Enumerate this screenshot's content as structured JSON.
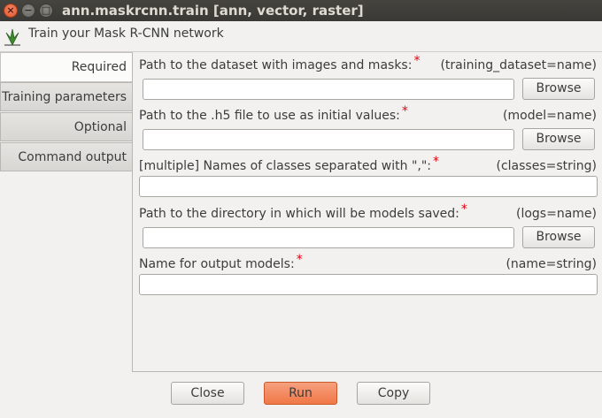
{
  "window": {
    "title": "ann.maskrcnn.train [ann, vector, raster]",
    "close_glyph": "×",
    "minimize_glyph": "−",
    "maximize_glyph": "□"
  },
  "header": {
    "icon": "grass-gis-icon",
    "title": "Train your Mask R-CNN network"
  },
  "tabs": [
    {
      "label": "Required",
      "active": true
    },
    {
      "label": "Training parameters",
      "active": false
    },
    {
      "label": "Optional",
      "active": false
    },
    {
      "label": "Command output",
      "active": false
    }
  ],
  "fields": {
    "dataset": {
      "label": "Path to the dataset with images and masks:",
      "required_mark": "*",
      "param": "(training_dataset=name)",
      "value": "",
      "browse": "Browse"
    },
    "model": {
      "label": "Path to the .h5 file to use as initial values:",
      "required_mark": "*",
      "param": "(model=name)",
      "value": "",
      "browse": "Browse"
    },
    "classes": {
      "label": "[multiple] Names of classes separated with \",\":",
      "required_mark": "*",
      "param": "(classes=string)",
      "value": ""
    },
    "logs": {
      "label": "Path to the directory in which will be models saved:",
      "required_mark": "*",
      "param": "(logs=name)",
      "value": "",
      "browse": "Browse"
    },
    "name": {
      "label": "Name for output models:",
      "required_mark": "*",
      "param": "(name=string)",
      "value": ""
    }
  },
  "buttons": {
    "close": "Close",
    "run": "Run",
    "copy": "Copy"
  },
  "colors": {
    "titlebar": "#3c3b37",
    "required_mark": "#e0000f",
    "run_button": "#f07746"
  }
}
